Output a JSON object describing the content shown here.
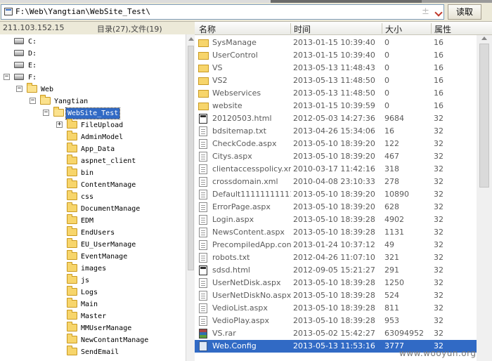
{
  "address": {
    "path": "F:\\Web\\Yangtian\\WebSite_Test\\",
    "plus_glyph": "±",
    "read_label": "读取"
  },
  "info": {
    "ip": "211.103.152.15",
    "summary": "目录(27),文件(19)"
  },
  "tree": {
    "drives": [
      "C:",
      "D:",
      "E:",
      "F:"
    ],
    "web": "Web",
    "yangtian": "Yangtian",
    "selected": "WebSite_Test",
    "children": [
      "FileUpload",
      "AdminModel",
      "App_Data",
      "aspnet_client",
      "bin",
      "ContentManage",
      "css",
      "DocumentManage",
      "EDM",
      "EndUsers",
      "EU_UserManage",
      "EventManage",
      "images",
      "js",
      "Logs",
      "Main",
      "Master",
      "MMUserManage",
      "NewContantManage",
      "SendEmail"
    ]
  },
  "list": {
    "headers": {
      "name": "名称",
      "time": "时间",
      "size": "大小",
      "attr": "属性"
    },
    "rows": [
      {
        "name": "SysManage",
        "time": "2013-01-15 10:39:40",
        "size": "0",
        "attr": "16",
        "icon": "folder"
      },
      {
        "name": "UserControl",
        "time": "2013-01-15 10:39:40",
        "size": "0",
        "attr": "16",
        "icon": "folder"
      },
      {
        "name": "VS",
        "time": "2013-05-13 11:48:43",
        "size": "0",
        "attr": "16",
        "icon": "folder"
      },
      {
        "name": "VS2",
        "time": "2013-05-13 11:48:50",
        "size": "0",
        "attr": "16",
        "icon": "folder"
      },
      {
        "name": "Webservices",
        "time": "2013-05-13 11:48:50",
        "size": "0",
        "attr": "16",
        "icon": "folder"
      },
      {
        "name": "website",
        "time": "2013-01-15 10:39:59",
        "size": "0",
        "attr": "16",
        "icon": "folder"
      },
      {
        "name": "20120503.html",
        "time": "2012-05-03 14:27:36",
        "size": "9684",
        "attr": "32",
        "icon": "html"
      },
      {
        "name": "bdsitemap.txt",
        "time": "2013-04-26 15:34:06",
        "size": "16",
        "attr": "32",
        "icon": "file"
      },
      {
        "name": "CheckCode.aspx",
        "time": "2013-05-10 18:39:20",
        "size": "122",
        "attr": "32",
        "icon": "file"
      },
      {
        "name": "Citys.aspx",
        "time": "2013-05-10 18:39:20",
        "size": "467",
        "attr": "32",
        "icon": "file"
      },
      {
        "name": "clientaccesspolicy.xml",
        "time": "2010-03-17 11:42:16",
        "size": "318",
        "attr": "32",
        "icon": "file"
      },
      {
        "name": "crossdomain.xml",
        "time": "2010-04-08 23:10:33",
        "size": "278",
        "attr": "32",
        "icon": "file"
      },
      {
        "name": "Default11111111111...",
        "time": "2013-05-10 18:39:20",
        "size": "10890",
        "attr": "32",
        "icon": "file"
      },
      {
        "name": "ErrorPage.aspx",
        "time": "2013-05-10 18:39:20",
        "size": "628",
        "attr": "32",
        "icon": "file"
      },
      {
        "name": "Login.aspx",
        "time": "2013-05-10 18:39:28",
        "size": "4902",
        "attr": "32",
        "icon": "file"
      },
      {
        "name": "NewsContent.aspx",
        "time": "2013-05-10 18:39:28",
        "size": "1131",
        "attr": "32",
        "icon": "file"
      },
      {
        "name": "PrecompiledApp.config",
        "time": "2013-01-24 10:37:12",
        "size": "49",
        "attr": "32",
        "icon": "file"
      },
      {
        "name": "robots.txt",
        "time": "2012-04-26 11:07:10",
        "size": "321",
        "attr": "32",
        "icon": "file"
      },
      {
        "name": "sdsd.html",
        "time": "2012-09-05 15:21:27",
        "size": "291",
        "attr": "32",
        "icon": "html"
      },
      {
        "name": "UserNetDisk.aspx",
        "time": "2013-05-10 18:39:28",
        "size": "1250",
        "attr": "32",
        "icon": "file"
      },
      {
        "name": "UserNetDiskNo.aspx",
        "time": "2013-05-10 18:39:28",
        "size": "524",
        "attr": "32",
        "icon": "file"
      },
      {
        "name": "VedioList.aspx",
        "time": "2013-05-10 18:39:28",
        "size": "811",
        "attr": "32",
        "icon": "file"
      },
      {
        "name": "VedioPlay.aspx",
        "time": "2013-05-10 18:39:28",
        "size": "953",
        "attr": "32",
        "icon": "file"
      },
      {
        "name": "VS.rar",
        "time": "2013-05-02 15:42:27",
        "size": "63094952",
        "attr": "32",
        "icon": "rar"
      },
      {
        "name": "Web.Config",
        "time": "2013-05-13 11:53:16",
        "size": "3777",
        "attr": "32",
        "icon": "config",
        "selected": true
      }
    ]
  },
  "watermark": "www.wooyun.org",
  "colors": {
    "selection": "#316ac5",
    "folder": "#f7d56b"
  }
}
